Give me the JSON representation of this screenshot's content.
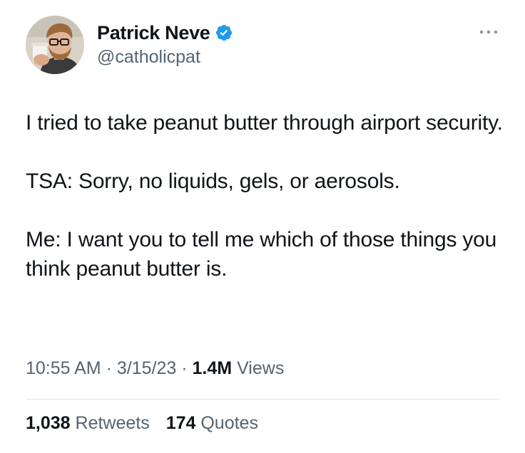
{
  "author": {
    "display_name": "Patrick Neve",
    "handle": "@catholicpat",
    "verified": true
  },
  "tweet": {
    "paragraphs": [
      "I tried to take peanut butter through airport security.",
      "TSA: Sorry, no liquids, gels, or aerosols.",
      "Me: I want you to tell me which of those things you think peanut butter is."
    ],
    "time": "10:55 AM",
    "date": "3/15/23",
    "separator": "·",
    "views_count": "1.4M",
    "views_label": "Views"
  },
  "stats": {
    "retweets_count": "1,038",
    "retweets_label": "Retweets",
    "quotes_count": "174",
    "quotes_label": "Quotes"
  },
  "colors": {
    "text": "#0f1419",
    "secondary": "#536471",
    "verified": "#1d9bf0",
    "divider": "#dfe3e6"
  },
  "icons": {
    "verified": "verified-badge-icon",
    "more": "more-options-icon"
  }
}
